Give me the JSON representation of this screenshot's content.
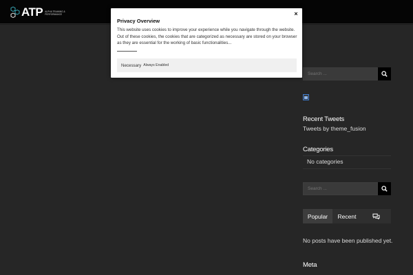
{
  "header": {
    "logo_text": "ATP",
    "logo_tagline_line1": "ALPHA TRAINING &",
    "logo_tagline_line2": "PERFORMANCE"
  },
  "modal": {
    "title": "Privacy Overview",
    "close_label": "×",
    "body": "This website uses cookies to improve your experience while you navigate through the website. Out of these cookies, the cookies that are categorized as necessary are stored on your browser as they are essential for the working of basic functionalities...",
    "necessary_label": "Necessary",
    "necessary_status": "Always Enabled"
  },
  "sidebar": {
    "search_top": {
      "placeholder": "Search ..."
    },
    "recent_tweets": {
      "title": "Recent Tweets",
      "text": "Tweets by theme_fusion"
    },
    "categories": {
      "title": "Categories",
      "text": "No categories"
    },
    "search_bottom": {
      "placeholder": "Search ..."
    },
    "tabs": {
      "popular": "Popular",
      "recent": "Recent",
      "comments_icon": "comments-icon"
    },
    "posts_empty": "No posts have been published yet.",
    "meta_title": "Meta"
  },
  "colors": {
    "header_bg": "#050505",
    "page_bg": "#262626",
    "accent_logo": "#3fb9c9"
  }
}
